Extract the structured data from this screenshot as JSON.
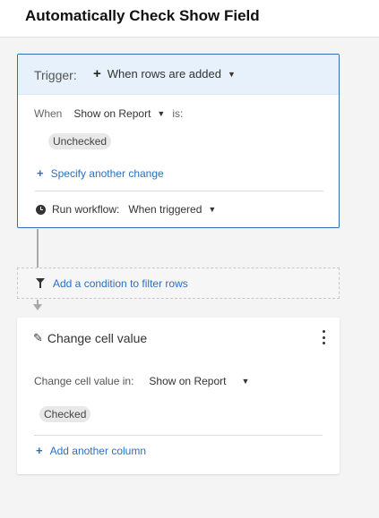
{
  "page": {
    "title": "Automatically Check Show Field"
  },
  "trigger": {
    "label": "Trigger:",
    "event_icon": "plus-icon",
    "event": "When rows are added",
    "when_label": "When",
    "field": "Show on Report",
    "is_label": "is:",
    "value_chip": "Unchecked",
    "specify_link": "Specify another change",
    "run_label": "Run workflow:",
    "run_value": "When triggered",
    "run_icon": "clock-icon"
  },
  "filter": {
    "label": "Add a condition to filter rows",
    "icon": "filter-icon"
  },
  "action": {
    "title": "Change cell value",
    "title_icon": "pencil-icon",
    "menu_icon": "kebab-menu-icon",
    "in_label": "Change cell value in:",
    "column": "Show on Report",
    "value_chip": "Checked",
    "add_column_link": "Add another column"
  },
  "colors": {
    "accent": "#2f6fb6",
    "link": "#2b6fc2",
    "trigger_header_bg": "#e6f1fb",
    "page_bg": "#f4f4f4"
  }
}
